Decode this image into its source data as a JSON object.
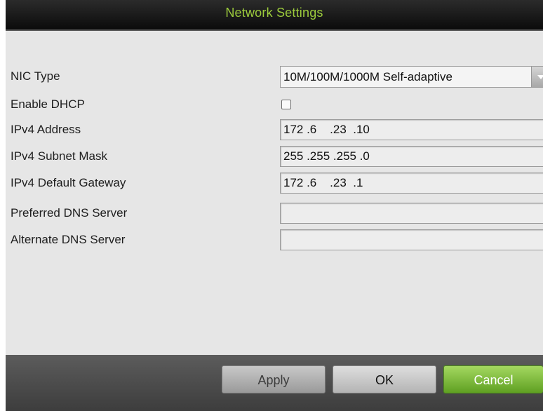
{
  "window": {
    "title": "Network Settings"
  },
  "settings": {
    "nic_type": {
      "label": "NIC Type",
      "value": "10M/100M/1000M Self-adaptive"
    },
    "enable_dhcp": {
      "label": "Enable DHCP",
      "checked": false
    },
    "ipv4_address": {
      "label": "IPv4 Address",
      "value": "172 .6    .23  .10"
    },
    "ipv4_subnet_mask": {
      "label": "IPv4 Subnet Mask",
      "value": "255 .255 .255 .0"
    },
    "ipv4_default_gateway": {
      "label": "IPv4 Default Gateway",
      "value": "172 .6    .23  .1"
    },
    "preferred_dns": {
      "label": "Preferred DNS Server",
      "value": ""
    },
    "alternate_dns": {
      "label": "Alternate DNS Server",
      "value": ""
    }
  },
  "buttons": {
    "apply": "Apply",
    "ok": "OK",
    "cancel": "Cancel"
  },
  "colors": {
    "title_text": "#9ccb3c",
    "cancel_button": "#5fa022"
  },
  "icons": {
    "nic_dropdown": "chevron-down-icon"
  }
}
